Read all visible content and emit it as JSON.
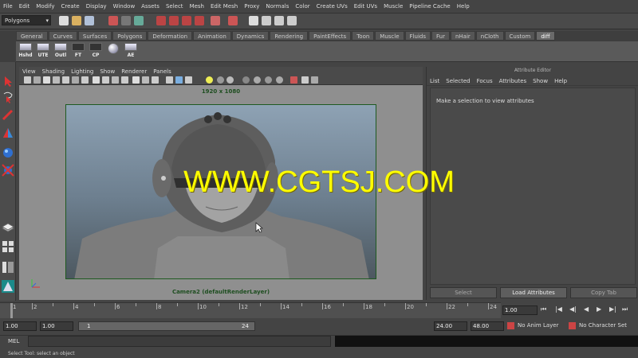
{
  "menubar": {
    "items": [
      "File",
      "Edit",
      "Modify",
      "Create",
      "Display",
      "Window",
      "Assets",
      "Select",
      "Mesh",
      "Edit Mesh",
      "Proxy",
      "Normals",
      "Color",
      "Create UVs",
      "Edit UVs",
      "Muscle",
      "Pipeline Cache",
      "Help"
    ]
  },
  "status": {
    "mode": "Polygons"
  },
  "shelf": {
    "tabs": [
      "General",
      "Curves",
      "Surfaces",
      "Polygons",
      "Deformation",
      "Animation",
      "Dynamics",
      "Rendering",
      "PaintEffects",
      "Toon",
      "Muscle",
      "Fluids",
      "Fur",
      "nHair",
      "nCloth",
      "Custom",
      "diff"
    ],
    "active_tab": "diff",
    "buttons": [
      "Hshd",
      "UTE",
      "Outl",
      "FT",
      "CP",
      "",
      "AE"
    ]
  },
  "viewport": {
    "menu": [
      "View",
      "Shading",
      "Lighting",
      "Show",
      "Renderer",
      "Panels"
    ],
    "resolution": "1920 x 1080",
    "camera": "Camera2 (defaultRenderLayer)"
  },
  "watermark": "WWW.CGTSJ.COM",
  "attribute_editor": {
    "title": "Attribute Editor",
    "menu": [
      "List",
      "Selected",
      "Focus",
      "Attributes",
      "Show",
      "Help"
    ],
    "message": "Make a selection to view attributes",
    "buttons": {
      "select": "Select",
      "load": "Load Attributes",
      "copy": "Copy Tab"
    }
  },
  "timeline": {
    "ticks": [
      "1",
      "2",
      "4",
      "6",
      "8",
      "10",
      "12",
      "14",
      "16",
      "18",
      "20",
      "22",
      "24"
    ],
    "current_frame": "1.00"
  },
  "range": {
    "start": "1.00",
    "playback_start": "1.00",
    "range_start_label": "1",
    "range_end_label": "24",
    "playback_end": "24.00",
    "end": "48.00",
    "anim_layer": "No Anim Layer",
    "character_set": "No Character Set"
  },
  "command": {
    "label": "MEL",
    "help": "Select Tool: select an object"
  },
  "colors": {
    "watermark": "#ffff00",
    "gate_border": "#1e5a20",
    "background": "#444444"
  }
}
